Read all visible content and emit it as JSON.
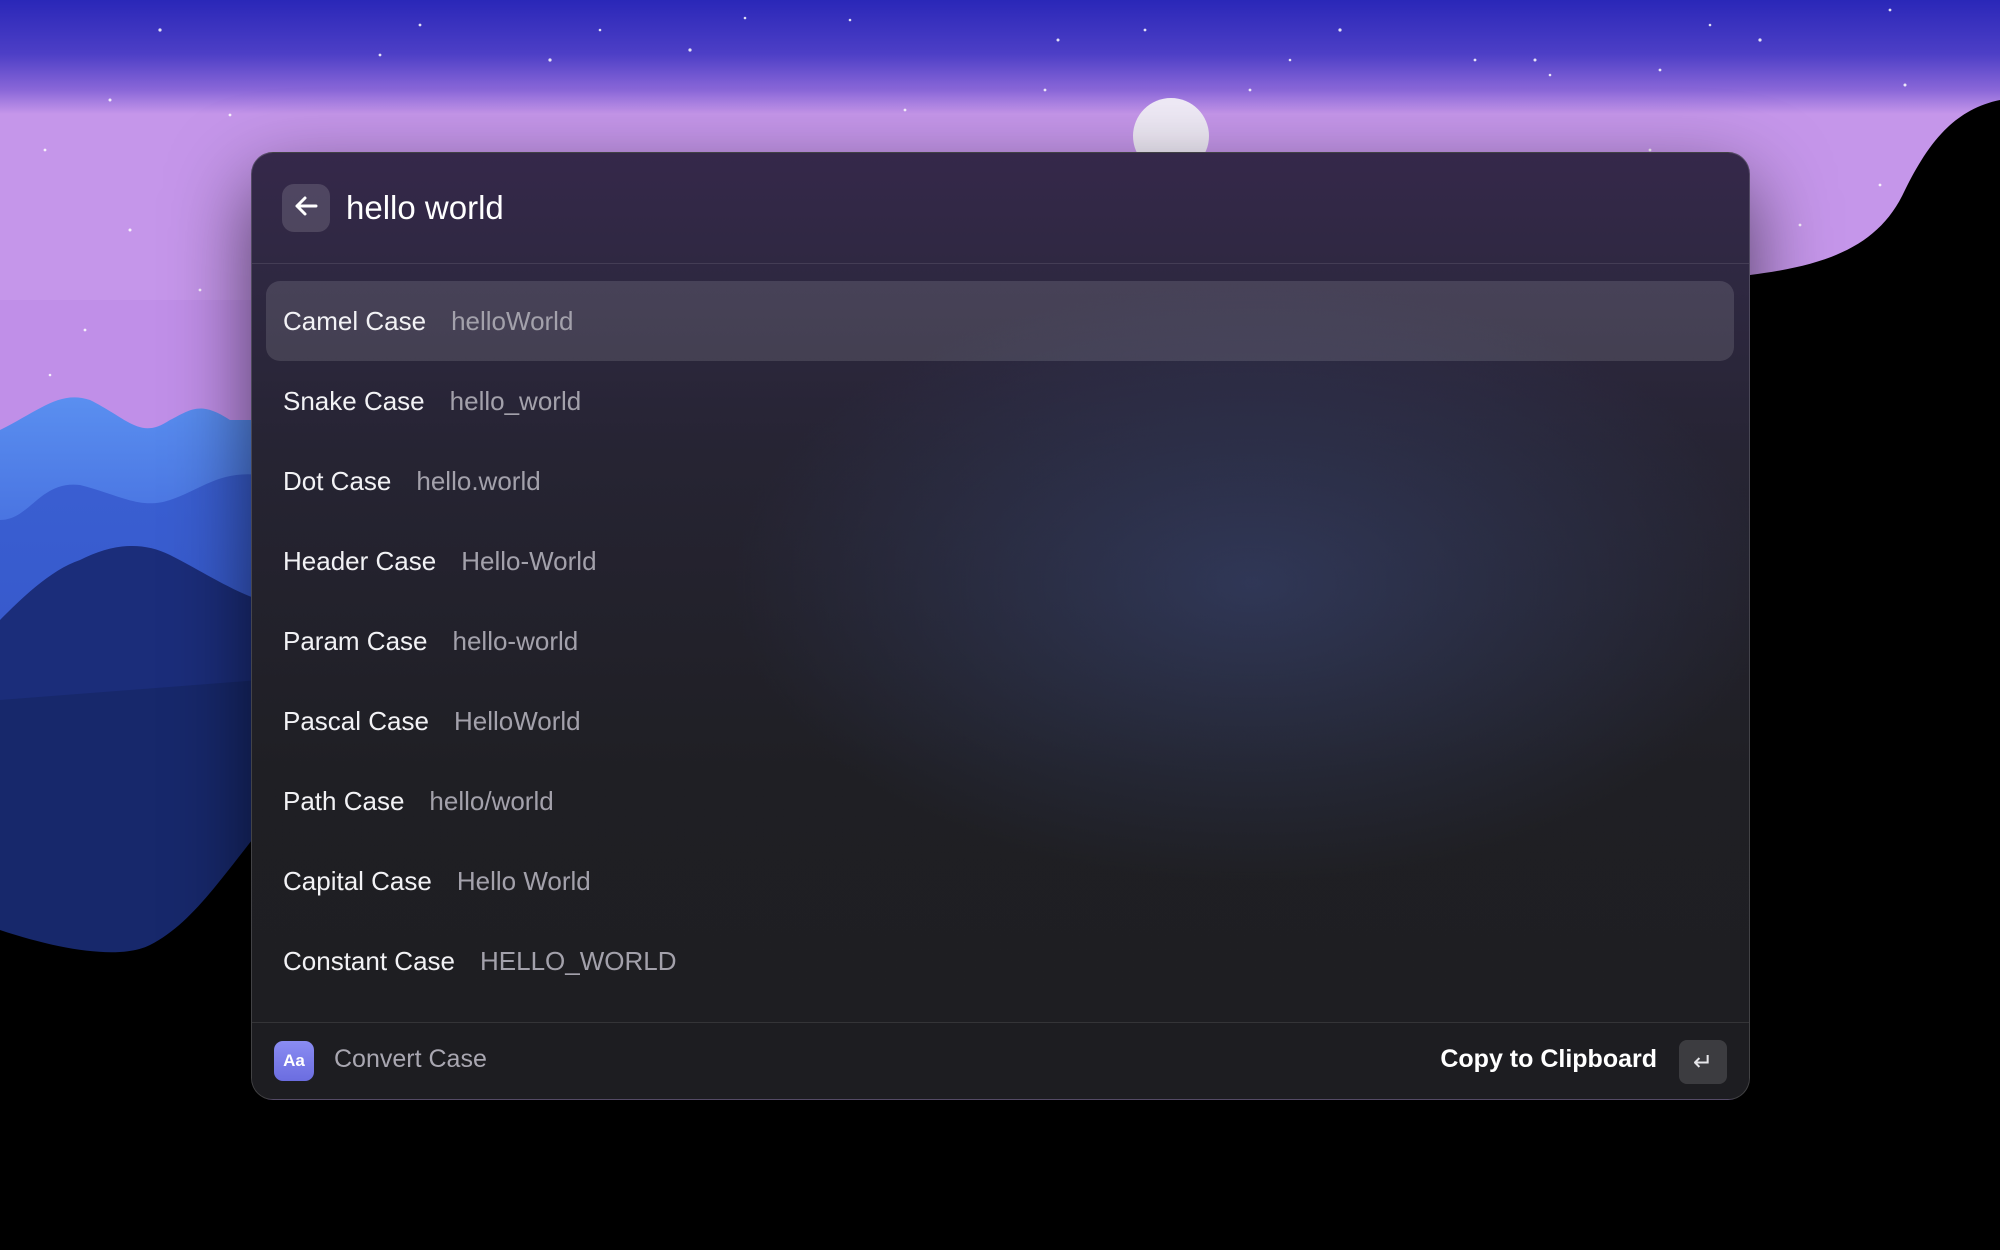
{
  "search": {
    "value": "hello world"
  },
  "results": [
    {
      "title": "Camel Case",
      "value": "helloWorld",
      "selected": true
    },
    {
      "title": "Snake Case",
      "value": "hello_world"
    },
    {
      "title": "Dot Case",
      "value": "hello.world"
    },
    {
      "title": "Header Case",
      "value": "Hello-World"
    },
    {
      "title": "Param Case",
      "value": "hello-world"
    },
    {
      "title": "Pascal Case",
      "value": "HelloWorld"
    },
    {
      "title": "Path Case",
      "value": "hello/world"
    },
    {
      "title": "Capital Case",
      "value": "Hello World"
    },
    {
      "title": "Constant Case",
      "value": "HELLO_WORLD"
    }
  ],
  "footer": {
    "icon_text": "Aa",
    "extension_name": "Convert Case",
    "primary_action": "Copy to Clipboard",
    "action_key": "↵"
  },
  "icons": {
    "back": "arrow-left-icon",
    "extension": "convert-case-icon",
    "enter": "return-key-icon"
  },
  "colors": {
    "accent": "#7a7ce8",
    "window_bg": "#1e1e21",
    "selection": "#3b3845"
  }
}
